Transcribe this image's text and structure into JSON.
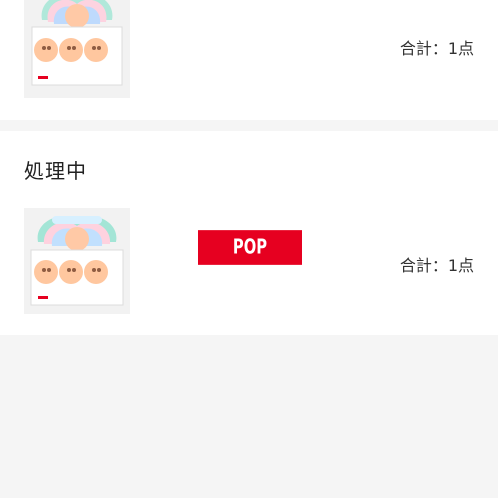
{
  "orders": [
    {
      "status": "",
      "image_icon": "blind-box-product-image",
      "total": "合計：1点"
    },
    {
      "status": "処理中",
      "image_icon": "blind-box-product-image",
      "brand_logo_text": "POP MART",
      "total": "合計：1点"
    }
  ],
  "colors": {
    "page_background": "#f5f5f5",
    "card_background": "#ffffff",
    "brand_red": "#e60020"
  }
}
